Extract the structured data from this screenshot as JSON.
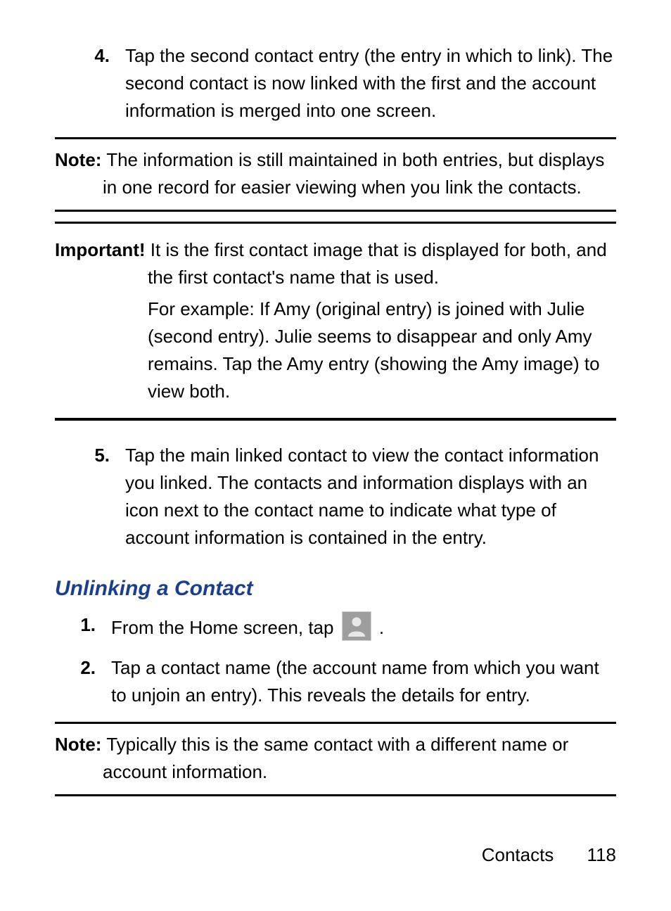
{
  "steps_top": [
    {
      "num": "4.",
      "text": "Tap the second contact entry (the entry in which to link). The second contact is now linked with the first and the account information is merged into one screen."
    }
  ],
  "note1": {
    "label": "Note:",
    "text": "The information is still maintained in both entries, but displays in one record for easier viewing when you link the contacts."
  },
  "important": {
    "label": "Important!",
    "text1": "It is the first contact image that is displayed for both, and the first contact's name that is used.",
    "text2": "For example: If Amy (original entry) is joined with Julie (second entry). Julie seems to disappear and only Amy remains. Tap the Amy entry (showing the Amy image) to view both."
  },
  "steps_mid": [
    {
      "num": "5.",
      "text": "Tap the main linked contact to view the contact information you linked. The contacts and information displays with an icon next to the contact name to indicate what type of account information is contained in the entry."
    }
  ],
  "section_title": "Unlinking a Contact",
  "unlink_steps": {
    "s1": {
      "num": "1.",
      "pre": "From the Home screen, tap ",
      "post": " ."
    },
    "s2": {
      "num": "2.",
      "text": "Tap a contact name (the account name from which you want to unjoin an entry). This reveals the details for entry."
    }
  },
  "note2": {
    "label": "Note:",
    "text": "Typically this is the same contact with a different name or account information."
  },
  "footer": {
    "section": "Contacts",
    "page": "118"
  }
}
